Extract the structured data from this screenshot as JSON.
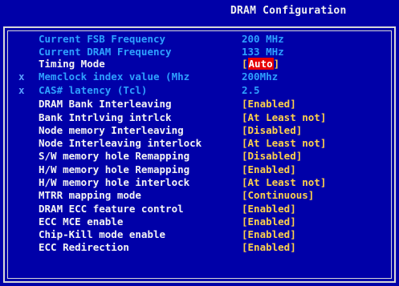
{
  "header": {
    "title": "DRAM Configuration"
  },
  "items": [
    {
      "mark": "",
      "label": "Current FSB Frequency",
      "value": "200 MHz",
      "style": "dim"
    },
    {
      "mark": "",
      "label": "Current DRAM Frequency",
      "value": "133 MHz",
      "style": "dim"
    },
    {
      "mark": "",
      "label": "Timing Mode",
      "value": "Auto",
      "style": "selected"
    },
    {
      "mark": "x",
      "label": "Memclock index value (Mhz",
      "value": "200Mhz",
      "style": "dim"
    },
    {
      "mark": "x",
      "label": "CAS# latency (Tcl)",
      "value": "2.5",
      "style": "dim"
    },
    {
      "mark": "",
      "label": "DRAM Bank Interleaving",
      "value": "[Enabled]",
      "style": "norm"
    },
    {
      "mark": "",
      "label": "Bank Intrlving intrlck",
      "value": "[At Least not]",
      "style": "norm"
    },
    {
      "mark": "",
      "label": "Node memory Interleaving",
      "value": "[Disabled]",
      "style": "norm"
    },
    {
      "mark": "",
      "label": "Node Interleaving interlock",
      "value": "[At Least not]",
      "style": "norm"
    },
    {
      "mark": "",
      "label": "S/W memory hole Remapping",
      "value": "[Disabled]",
      "style": "norm"
    },
    {
      "mark": "",
      "label": "H/W memory hole Remapping",
      "value": "[Enabled]",
      "style": "norm"
    },
    {
      "mark": "",
      "label": "H/W memory hole interlock",
      "value": "[At Least not]",
      "style": "norm"
    },
    {
      "mark": "",
      "label": "MTRR mapping mode",
      "value": "[Continuous]",
      "style": "norm"
    },
    {
      "mark": "",
      "label": "DRAM ECC feature control",
      "value": "[Enabled]",
      "style": "norm"
    },
    {
      "mark": "",
      "label": "ECC MCE enable",
      "value": "[Enabled]",
      "style": "norm"
    },
    {
      "mark": "",
      "label": "Chip-Kill mode enable",
      "value": "[Enabled]",
      "style": "norm"
    },
    {
      "mark": "",
      "label": "ECC Redirection",
      "value": "[Enabled]",
      "style": "norm"
    }
  ],
  "colors": {
    "background": "#0000a8",
    "dim_text": "#2ea0ff",
    "label_text": "#f4f4f4",
    "value_text": "#ffd24a",
    "highlight": "#e60000"
  }
}
